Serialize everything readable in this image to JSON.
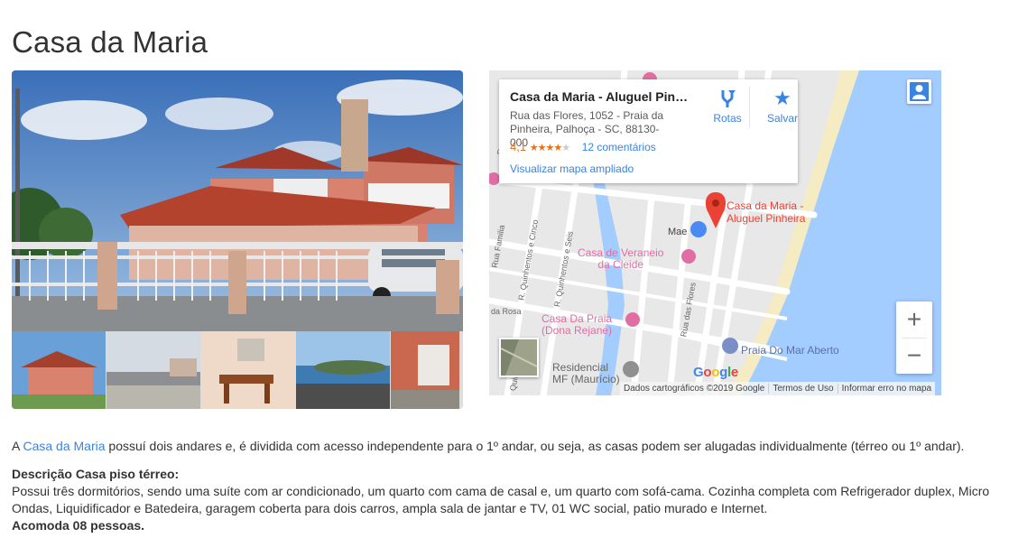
{
  "page": {
    "title": "Casa da Maria"
  },
  "gallery": {
    "thumbnails": [
      "thumb-house-front",
      "thumb-street",
      "thumb-dining",
      "thumb-sea-view",
      "thumb-house-side"
    ]
  },
  "map": {
    "place_name": "Casa da Maria - Aluguel Pinhe...",
    "address": "Rua das Flores, 1052 - Praia da Pinheira, Palhoça - SC, 88130-000",
    "rating": "4,1",
    "stars_filled": 4,
    "stars_total": 5,
    "reviews_link": "12 comentários",
    "bigger_map_link": "Visualizar mapa ampliado",
    "directions_label": "Rotas",
    "save_label": "Salvar",
    "marker_label_line1": "Casa da Maria -",
    "marker_label_line2": "Aluguel Pinheira",
    "poi": {
      "mae": "Mae",
      "casa_veraneio_1": "Casa de Veraneio",
      "casa_veraneio_2": "da Cleide",
      "casa_praia_1": "Casa Da Praia",
      "casa_praia_2": "(Dona Rejane)",
      "praia_mar_aberto": "Praia Do Mar Aberto",
      "residencial_1": "Residencial",
      "residencial_2": "MF (Maurício)"
    },
    "streets": {
      "rua_familia": "Rua Familia",
      "quinhentos_cinco": "R. Quinhentos e Cinco",
      "quinhentos_seis": "R. Quinhentos e Seis",
      "da_rosa": "da Rosa",
      "quinhentos_top": "R. Quinhentos",
      "quinh_bottom": "Quinh",
      "rua_das_flores": "Rua das Flores"
    },
    "zoom_in": "+",
    "zoom_out": "−",
    "google_logo": "Google",
    "footer": {
      "data": "Dados cartográficos ©2019 Google",
      "terms": "Termos de Uso",
      "report": "Informar erro no mapa"
    },
    "colors": {
      "water": "#a3ccff",
      "land": "#e8e8e8",
      "sand": "#f5ecc4",
      "poi_pink": "#e06ea2",
      "marker_red": "#ea4335",
      "link_blue": "#3a84df"
    }
  },
  "description": {
    "intro_before": "A ",
    "intro_link": "Casa da Maria",
    "intro_after": " possuí dois andares e, é dividida com acesso independente para o 1º andar, ou seja, as casas podem ser alugadas individualmente (térreo ou 1º andar).",
    "ground_floor_heading": "Descrição Casa piso térreo:",
    "ground_floor_text": "Possui três dormitórios, sendo uma suíte com ar condicionado, um quarto com cama de casal e, um quarto com sofá-cama. Cozinha completa com Refrigerador duplex, Micro Ondas, Liquidificador e Batedeira, garagem coberta para dois carros, ampla sala de jantar e TV, 01 WC social, patio murado e Internet.",
    "capacity": "Acomoda 08 pessoas."
  }
}
